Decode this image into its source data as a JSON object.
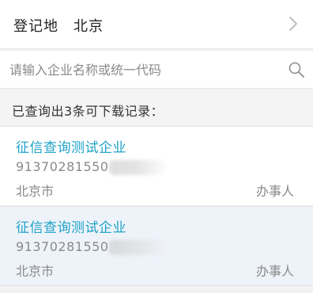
{
  "region": {
    "label": "登记地",
    "value": "北京",
    "chevron_icon": "chevron-right-icon"
  },
  "search": {
    "placeholder": "请输入企业名称或统一代码",
    "value": "",
    "icon": "search-icon"
  },
  "summary": {
    "text": "已查询出3条可下载记录："
  },
  "records": [
    {
      "name": "征信查询测试企业",
      "code": "91370281550",
      "city": "北京市",
      "role": "办事人"
    },
    {
      "name": "征信查询测试企业",
      "code": "91370281550",
      "city": "北京市",
      "role": "办事人"
    }
  ],
  "colors": {
    "accent": "#1fa3c8",
    "selected_row_bg": "#eef3fa"
  }
}
